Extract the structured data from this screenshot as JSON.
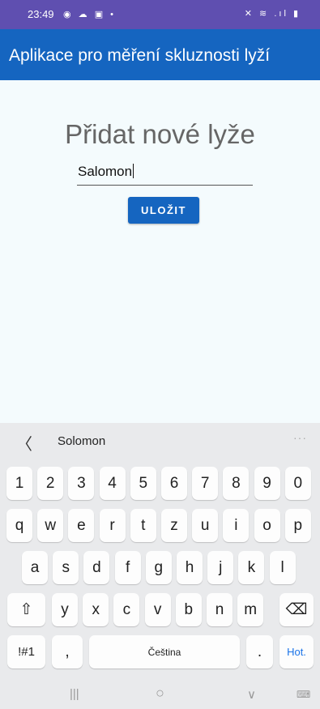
{
  "status_bar": {
    "time": "23:49",
    "left_icons": "◉ ☁ ▣ •",
    "right_icons": "✕ ≋ .ıl ▮"
  },
  "app_bar": {
    "title": "Aplikace pro měření skluznosti lyží"
  },
  "main": {
    "heading": "Přidat nové lyže",
    "input_value": "Salomon",
    "save_label": "ULOŽIT"
  },
  "keyboard": {
    "suggestion": "Solomon",
    "back_glyph": "〈",
    "more_glyph": "···",
    "row1": [
      "1",
      "2",
      "3",
      "4",
      "5",
      "6",
      "7",
      "8",
      "9",
      "0"
    ],
    "row2": [
      "q",
      "w",
      "e",
      "r",
      "t",
      "z",
      "u",
      "i",
      "o",
      "p"
    ],
    "row3": [
      "a",
      "s",
      "d",
      "f",
      "g",
      "h",
      "j",
      "k",
      "l"
    ],
    "row4": [
      "y",
      "x",
      "c",
      "v",
      "b",
      "n",
      "m"
    ],
    "shift_glyph": "⇧",
    "backspace_glyph": "⌫",
    "symbols_label": "!#1",
    "comma_label": ",",
    "space_label": "Čeština",
    "period_label": ".",
    "action_label": "Hot."
  },
  "nav_bar": {
    "recents_glyph": "|||",
    "home_glyph": "○",
    "back_glyph": "∨",
    "keyboard_glyph": "⌨"
  },
  "colors": {
    "app_bar": "#1565c0",
    "status_bar": "#5f4fb0",
    "background": "#f4fbfd"
  }
}
